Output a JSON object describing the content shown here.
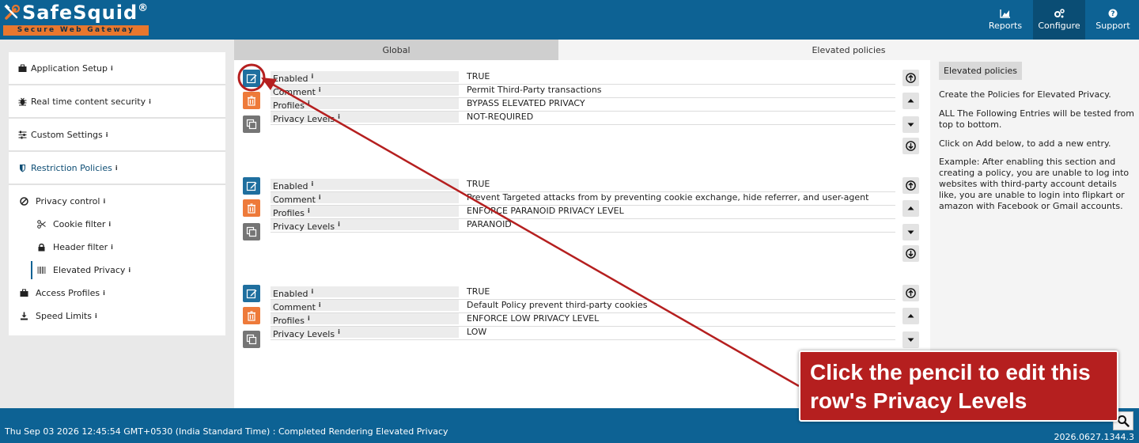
{
  "brand": {
    "name": "SafeSquid",
    "registered": "®",
    "tagline": "Secure Web Gateway"
  },
  "nav": {
    "items": [
      {
        "label": "Reports",
        "icon": "bar-chart-icon"
      },
      {
        "label": "Configure",
        "icon": "gears-icon",
        "active": true
      },
      {
        "label": "Support",
        "icon": "help-icon"
      }
    ]
  },
  "tabs": [
    {
      "label": "Global"
    },
    {
      "label": "Elevated policies",
      "active": true
    }
  ],
  "sidebar": {
    "items": [
      {
        "label": "Application Setup",
        "icon": "briefcase-icon"
      },
      {
        "label": "Real time content security",
        "icon": "bug-icon"
      },
      {
        "label": "Custom Settings",
        "icon": "sliders-icon"
      },
      {
        "label": "Restriction Policies",
        "icon": "shield-icon",
        "active": true
      }
    ],
    "subitems": [
      {
        "label": "Privacy control",
        "icon": "ban-icon",
        "level": 1
      },
      {
        "label": "Cookie filter",
        "icon": "scissors-icon",
        "level": 2
      },
      {
        "label": "Header filter",
        "icon": "lock-icon",
        "level": 2
      },
      {
        "label": "Elevated Privacy",
        "icon": "barcode-icon",
        "level": 2,
        "selected": true
      },
      {
        "label": "Access Profiles",
        "icon": "briefcase-icon",
        "level": 1
      },
      {
        "label": "Speed Limits",
        "icon": "download-icon",
        "level": 1
      }
    ],
    "info_mark": "i"
  },
  "policies": [
    {
      "rows": [
        {
          "label": "Enabled",
          "value": "TRUE"
        },
        {
          "label": "Comment",
          "value": "Permit Third-Party transactions"
        },
        {
          "label": "Profiles",
          "value": "BYPASS ELEVATED PRIVACY"
        },
        {
          "label": "Privacy Levels",
          "value": "NOT-REQUIRED"
        }
      ]
    },
    {
      "rows": [
        {
          "label": "Enabled",
          "value": "TRUE"
        },
        {
          "label": "Comment",
          "value": "Prevent Targeted attacks from by preventing cookie exchange, hide referrer, and user-agent"
        },
        {
          "label": "Profiles",
          "value": "ENFORCE PARANOID PRIVACY LEVEL"
        },
        {
          "label": "Privacy Levels",
          "value": "PARANOID"
        }
      ]
    },
    {
      "rows": [
        {
          "label": "Enabled",
          "value": "TRUE"
        },
        {
          "label": "Comment",
          "value": "Default Policy prevent third-party cookies"
        },
        {
          "label": "Profiles",
          "value": "ENFORCE LOW PRIVACY LEVEL"
        },
        {
          "label": "Privacy Levels",
          "value": "LOW"
        }
      ]
    }
  ],
  "info": {
    "title": "Elevated policies",
    "paragraphs": [
      "Create the Policies for Elevated Privacy.",
      "ALL The Following Entries will be tested from top to bottom.",
      "Click on Add below, to add a new entry.",
      "Example: After enabling this section and creating a policy, you are unable to log into websites with third-party account details like, you are unable to login into flipkart or amazon with Facebook or Gmail accounts."
    ]
  },
  "footer": {
    "status": "Thu Sep 03 2026 12:45:54 GMT+0530 (India Standard Time) : Completed Rendering Elevated Privacy",
    "version": "2026.0627.1344.3"
  },
  "annotation": {
    "callout_text": "Click the pencil to edit this row's Privacy Levels",
    "color": "#b51f1f"
  },
  "colors": {
    "header": "#0d6294",
    "accent_orange": "#e8772e",
    "edit_button": "#1f6f9f",
    "delete_button": "#ee7a3a",
    "copy_button": "#757575"
  }
}
